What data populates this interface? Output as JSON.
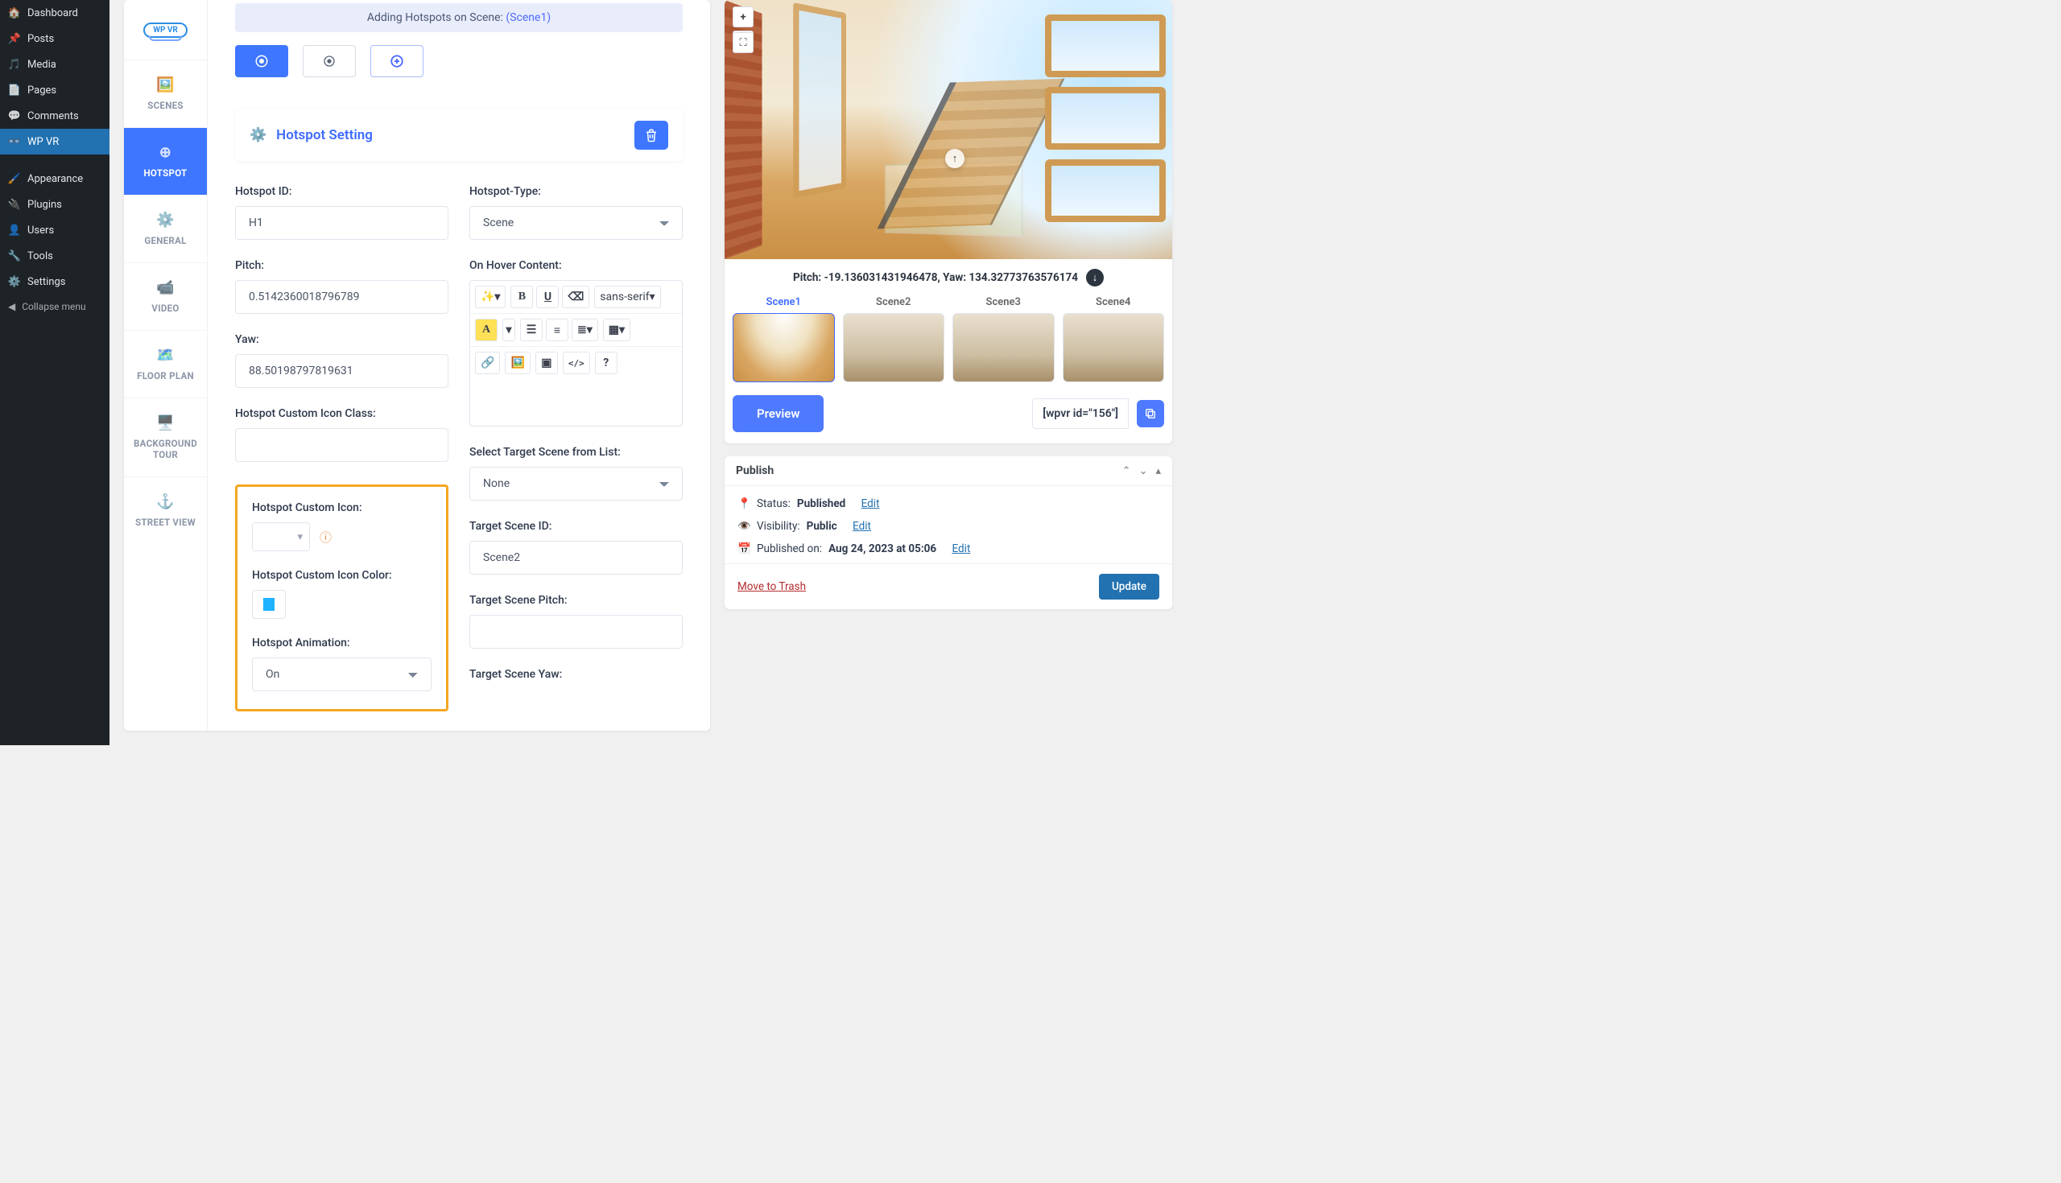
{
  "wp_menu": {
    "dashboard": "Dashboard",
    "posts": "Posts",
    "media": "Media",
    "pages": "Pages",
    "comments": "Comments",
    "wpvr": "WP VR",
    "appearance": "Appearance",
    "plugins": "Plugins",
    "users": "Users",
    "tools": "Tools",
    "settings": "Settings",
    "collapse": "Collapse menu"
  },
  "tabs": {
    "logo": "WP VR",
    "scenes": "SCENES",
    "hotspot": "HOTSPOT",
    "general": "GENERAL",
    "video": "VIDEO",
    "floor": "FLOOR PLAN",
    "bg": "BACKGROUND TOUR",
    "street": "STREET VIEW"
  },
  "banner": {
    "text": "Adding Hotspots on Scene: ",
    "scene": "(Scene1)"
  },
  "section_title": "Hotspot Setting",
  "fields": {
    "hotspot_id_label": "Hotspot ID:",
    "hotspot_id": "H1",
    "pitch_label": "Pitch:",
    "pitch": "0.5142360018796789",
    "yaw_label": "Yaw:",
    "yaw": "88.50198797819631",
    "custom_class_label": "Hotspot Custom Icon Class:",
    "custom_class": "",
    "custom_icon_label": "Hotspot Custom Icon:",
    "custom_color_label": "Hotspot Custom Icon Color:",
    "animation_label": "Hotspot Animation:",
    "animation": "On",
    "type_label": "Hotspot-Type:",
    "type": "Scene",
    "hover_label": "On Hover Content:",
    "target_scene_list_label": "Select Target Scene from List:",
    "target_scene_list": "None",
    "target_scene_id_label": "Target Scene ID:",
    "target_scene_id": "Scene2",
    "target_pitch_label": "Target Scene Pitch:",
    "target_pitch": "",
    "target_yaw_label": "Target Scene Yaw:"
  },
  "editor_toolbar": {
    "font": "sans-serif"
  },
  "preview": {
    "pitch_yaw": "Pitch: -19.136031431946478, Yaw: 134.32773763576174",
    "btn": "Preview",
    "shortcode": "[wpvr id=\"156\"]",
    "scenes": [
      "Scene1",
      "Scene2",
      "Scene3",
      "Scene4"
    ]
  },
  "publish": {
    "title": "Publish",
    "status_label": "Status: ",
    "status_value": "Published",
    "edit": "Edit",
    "visibility_label": "Visibility: ",
    "visibility_value": "Public",
    "published_label": "Published on: ",
    "published_value": "Aug 24, 2023 at 05:06",
    "trash": "Move to Trash",
    "update": "Update"
  }
}
